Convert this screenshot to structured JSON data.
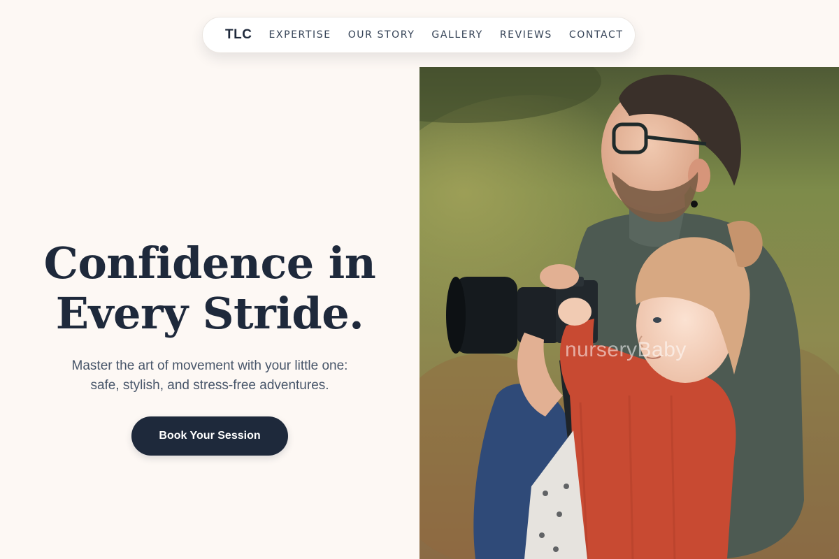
{
  "nav": {
    "brand": "TLC",
    "links": [
      "EXPERTISE",
      "OUR STORY",
      "GALLERY",
      "REVIEWS",
      "CONTACT"
    ]
  },
  "hero": {
    "headline_line1": "Confidence in",
    "headline_line2": "Every Stride.",
    "subtitle_line1": "Master the art of movement with your little one:",
    "subtitle_line2": "safe, stylish, and stress-free adventures.",
    "cta_label": "Book Your Session"
  },
  "photo": {
    "watermark": "nurseryBaby",
    "alt": "Father kneeling outdoors helping his toddler daughter hold a camera"
  },
  "colors": {
    "page_background": "#fdf8f4",
    "navy": "#1e293b",
    "text_muted": "#475569",
    "sweater_rust": "#c84a32"
  },
  "icons": {}
}
